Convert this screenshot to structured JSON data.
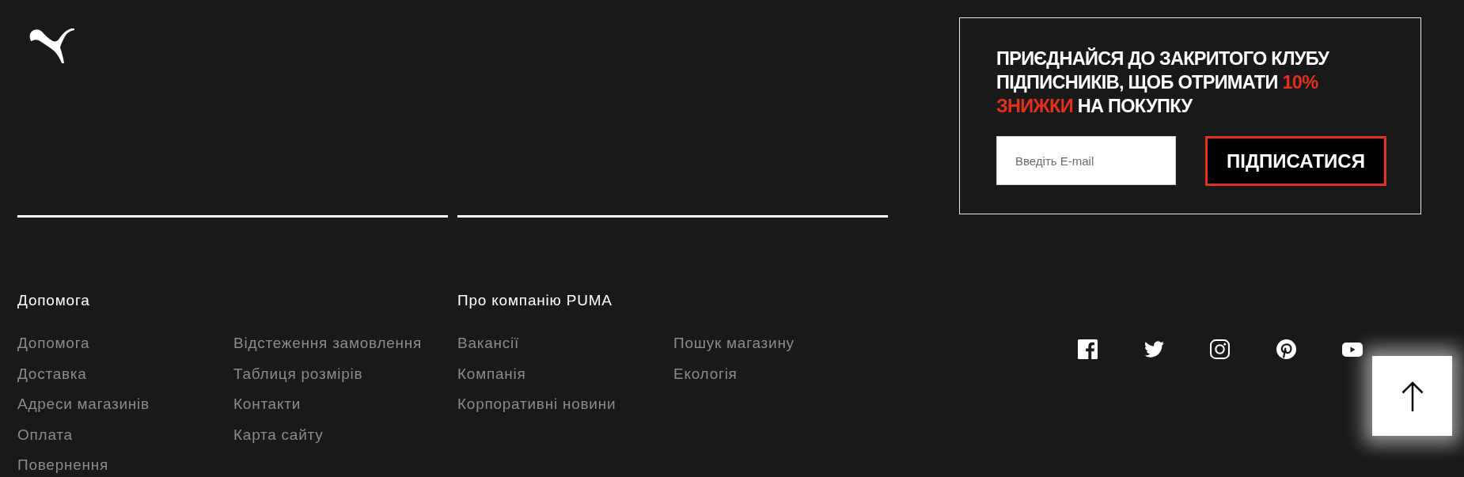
{
  "newsletter": {
    "heading": [
      {
        "text": "ПРИЄДНАЙСЯ ДО ЗАКРИТОГО КЛУБУ ПІДПИСНИКІВ, ЩОБ ОТРИМАТИ ",
        "highlight": false
      },
      {
        "text": "10% ЗНИЖКИ",
        "highlight": true
      },
      {
        "text": " НА ПОКУПКУ",
        "highlight": false
      }
    ],
    "email_field": {
      "placeholder": "Введіть E-mail"
    },
    "subscribe_button": "ПІДПИСАТИСЯ"
  },
  "footer_sections": [
    {
      "title": "Допомога",
      "columns": [
        {
          "links": [
            "Допомога",
            "Доставка",
            "Адреси магазинів",
            "Оплата",
            "Повернення"
          ]
        },
        {
          "links": [
            "Відстеження замовлення",
            "Таблиця розмірів",
            "Контакти",
            "Карта сайту"
          ]
        }
      ]
    },
    {
      "title": "Про компанію PUMA",
      "columns": [
        {
          "links": [
            "Вакансії",
            "Компанія",
            "Корпоративні новини"
          ]
        },
        {
          "links": [
            "Пошук магазину",
            "Екологія"
          ]
        }
      ]
    }
  ]
}
